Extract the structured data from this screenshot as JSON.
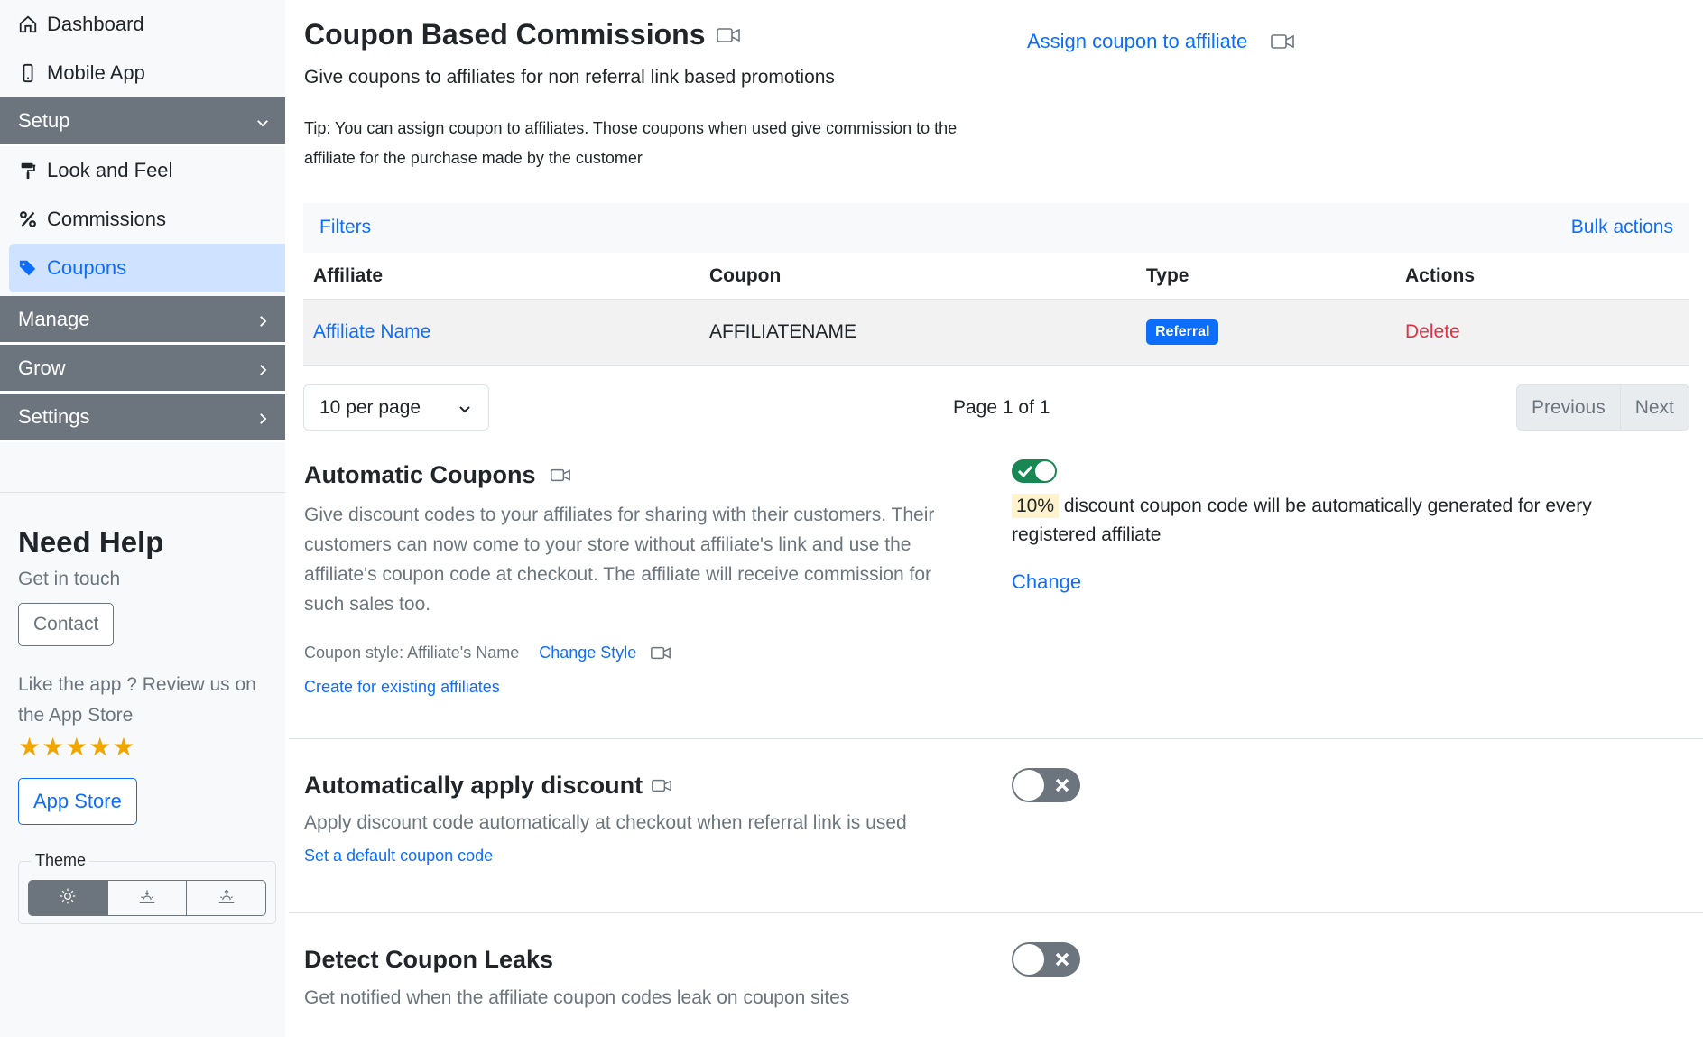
{
  "sidebar": {
    "top_items": [
      {
        "label": "Dashboard",
        "icon": "home-icon"
      },
      {
        "label": "Mobile App",
        "icon": "phone-icon"
      }
    ],
    "setup": {
      "label": "Setup",
      "items": [
        {
          "label": "Look and Feel",
          "icon": "paint-roller-icon"
        },
        {
          "label": "Commissions",
          "icon": "percent-icon"
        },
        {
          "label": "Coupons",
          "icon": "tags-icon",
          "active": true
        }
      ]
    },
    "sections": [
      {
        "label": "Manage"
      },
      {
        "label": "Grow"
      },
      {
        "label": "Settings"
      }
    ],
    "help": {
      "title": "Need Help",
      "subtitle": "Get in touch",
      "contact_label": "Contact",
      "review_text": "Like the app ? Review us on the App Store",
      "stars": "★★★★★",
      "app_store_label": "App Store"
    },
    "theme": {
      "legend": "Theme",
      "options": [
        "sun-icon",
        "sunset-icon",
        "sunrise-icon"
      ],
      "selected": 0
    }
  },
  "main": {
    "title": "Coupon Based Commissions",
    "subtitle": "Give coupons to affiliates for non referral link based promotions",
    "tip": "Tip: You can assign coupon to affiliates. Those coupons when used give commission to the affiliate for the purchase made by the customer",
    "assign_link": "Assign coupon to affiliate",
    "filters_label": "Filters",
    "bulk_actions_label": "Bulk actions",
    "table": {
      "headers": [
        "Affiliate",
        "Coupon",
        "Type",
        "Actions"
      ],
      "rows": [
        {
          "affiliate": "Affiliate Name",
          "coupon": "AFFILIATENAME",
          "type": "Referral",
          "action": "Delete"
        }
      ]
    },
    "pagination": {
      "per_page": "10 per page",
      "page_info": "Page 1 of 1",
      "previous": "Previous",
      "next": "Next"
    },
    "automatic_coupons": {
      "title": "Automatic Coupons",
      "description": "Give discount codes to your affiliates for sharing with their customers. Their customers can now come to your store without affiliate's link and use the affiliate's coupon code at checkout. The affiliate will receive commission for such sales too.",
      "coupon_style": "Coupon style: Affiliate's Name",
      "change_style": "Change Style",
      "create_existing": "Create for existing affiliates",
      "enabled": true,
      "discount": "10%",
      "discount_text": "discount coupon code will be automatically generated for every registered affiliate",
      "change_label": "Change"
    },
    "auto_apply": {
      "title": "Automatically apply discount",
      "description": "Apply discount code automatically at checkout when referral link is used",
      "link": "Set a default coupon code",
      "enabled": false
    },
    "leaks": {
      "title": "Detect Coupon Leaks",
      "description": "Get notified when the affiliate coupon codes leak on coupon sites",
      "enabled": false
    }
  },
  "colors": {
    "primary": "#0d6efd",
    "secondary": "#6c757d",
    "success": "#198754",
    "danger": "#dc3545",
    "active_bg": "#cfe2ff",
    "highlight": "#fff3cd"
  }
}
